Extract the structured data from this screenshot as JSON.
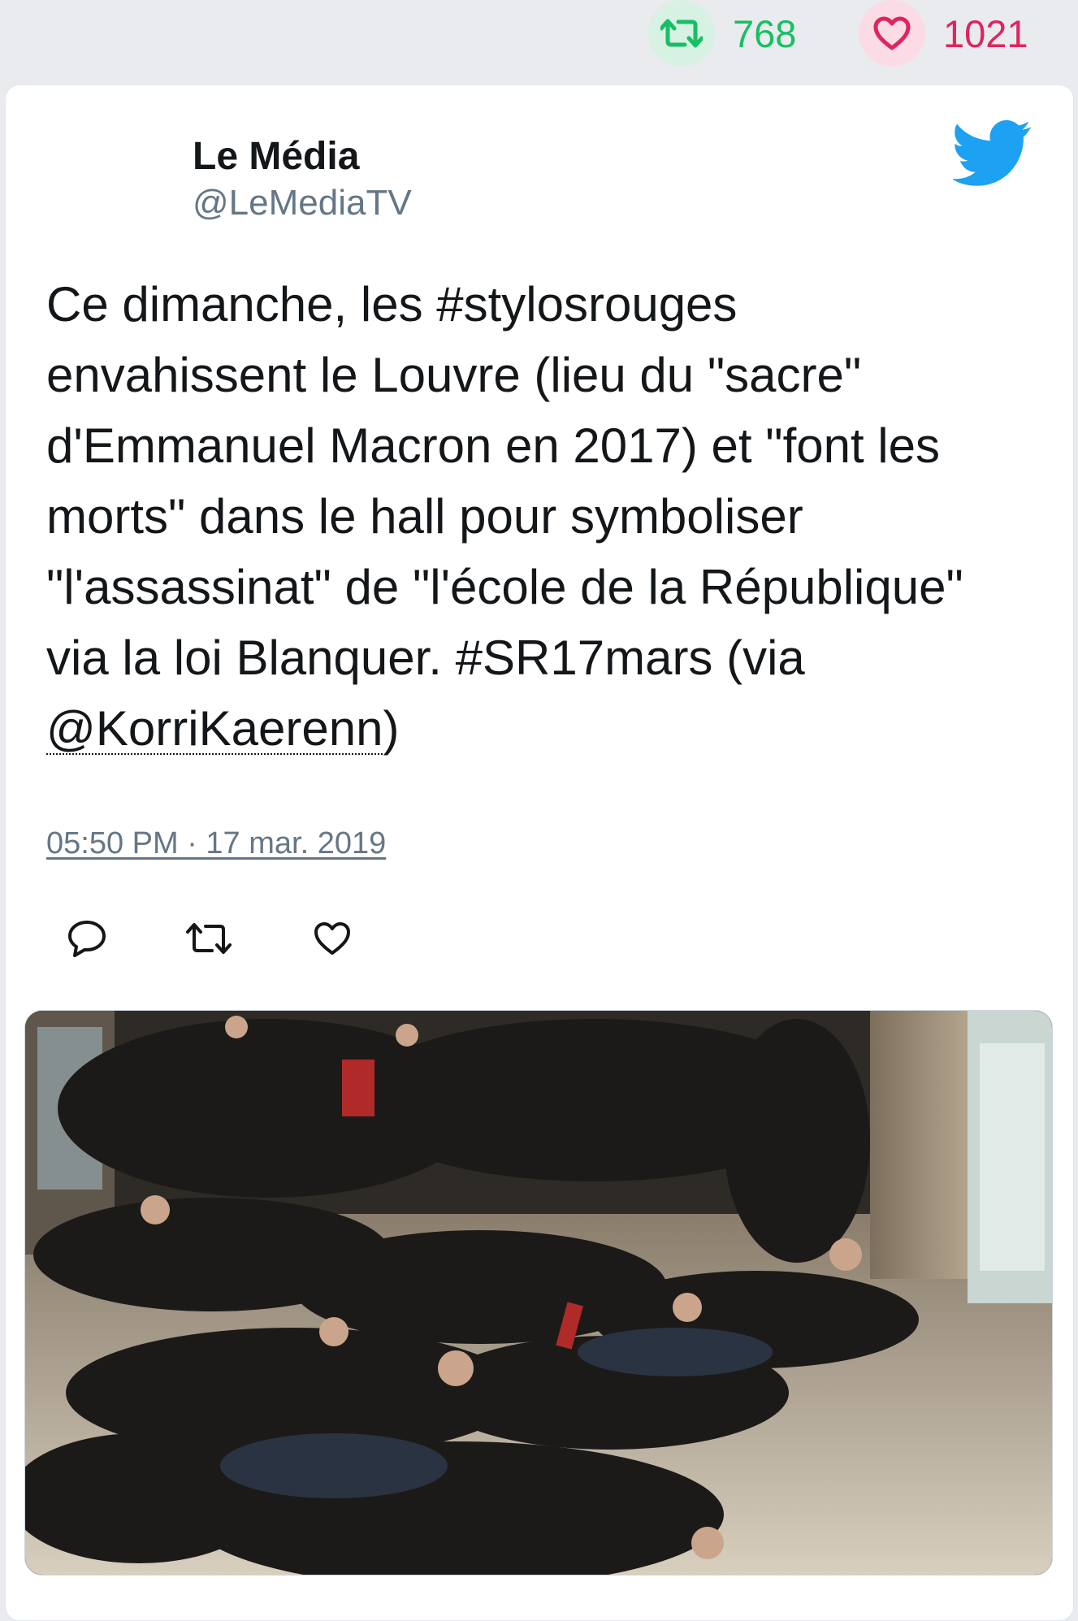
{
  "stats": {
    "retweet_icon": "retweet-icon",
    "retweet_count": "768",
    "like_icon": "heart-icon",
    "like_count": "1021",
    "colors": {
      "retweet": "#17bf63",
      "like": "#e0245e"
    }
  },
  "author": {
    "name": "Le Média",
    "handle": "@LeMediaTV",
    "platform_icon": "twitter-bird-icon",
    "brand_color": "#1da1f2"
  },
  "tweet": {
    "text_before_mention": "Ce dimanche, les #stylosrouges envahissent le Louvre (lieu du \"sacre\" d'Emmanuel Macron en 2017) et \"font les morts\" dans le hall pour symboliser \"l'assassinat\" de \"l'école de la République\" via la loi Blanquer. #SR17mars (via ",
    "mention": "@KorriKaerenn",
    "text_after_mention": ")",
    "timestamp": "05:50 PM · 17 mar. 2019"
  },
  "actions": [
    {
      "name": "reply",
      "icon": "reply-icon"
    },
    {
      "name": "retweet",
      "icon": "retweet-icon"
    },
    {
      "name": "like",
      "icon": "heart-icon"
    }
  ],
  "media": {
    "kind": "photo"
  }
}
